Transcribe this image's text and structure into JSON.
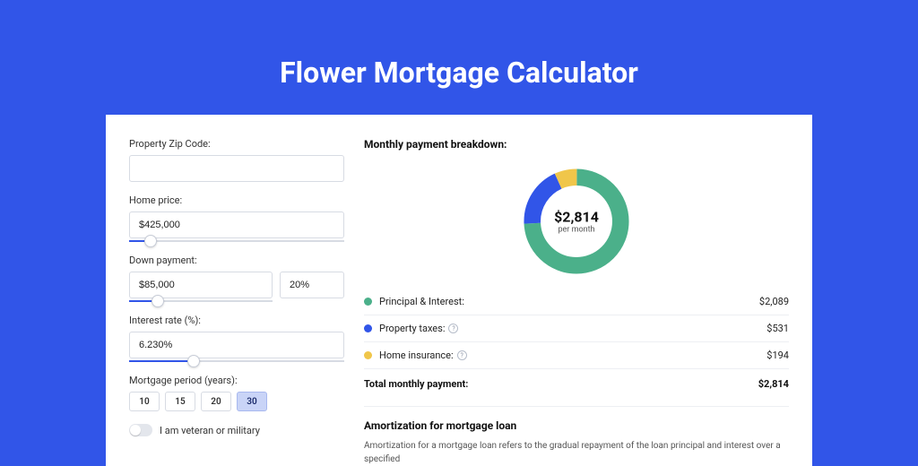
{
  "title": "Flower Mortgage Calculator",
  "form": {
    "zip_label": "Property Zip Code:",
    "zip_value": "",
    "home_price_label": "Home price:",
    "home_price_value": "$425,000",
    "down_payment_label": "Down payment:",
    "down_payment_amount": "$85,000",
    "down_payment_pct": "20%",
    "interest_label": "Interest rate (%):",
    "interest_value": "6.230%",
    "period_label": "Mortgage period (years):",
    "periods": [
      "10",
      "15",
      "20",
      "30"
    ],
    "period_selected": "30",
    "veteran_label": "I am veteran or military"
  },
  "breakdown": {
    "title": "Monthly payment breakdown:",
    "center_amount": "$2,814",
    "center_sub": "per month",
    "items": [
      {
        "label": "Principal & Interest:",
        "value": "$2,089",
        "color": "green",
        "help": false
      },
      {
        "label": "Property taxes:",
        "value": "$531",
        "color": "blue",
        "help": true
      },
      {
        "label": "Home insurance:",
        "value": "$194",
        "color": "yellow",
        "help": true
      }
    ],
    "total_label": "Total monthly payment:",
    "total_value": "$2,814"
  },
  "amort": {
    "title": "Amortization for mortgage loan",
    "text": "Amortization for a mortgage loan refers to the gradual repayment of the loan principal and interest over a specified"
  },
  "chart_data": {
    "type": "pie",
    "title": "Monthly payment breakdown",
    "series": [
      {
        "name": "Principal & Interest",
        "value": 2089,
        "color": "#4bb08a"
      },
      {
        "name": "Property taxes",
        "value": 531,
        "color": "#3155e8"
      },
      {
        "name": "Home insurance",
        "value": 194,
        "color": "#f0c64a"
      }
    ],
    "total": 2814,
    "unit": "$ per month"
  }
}
